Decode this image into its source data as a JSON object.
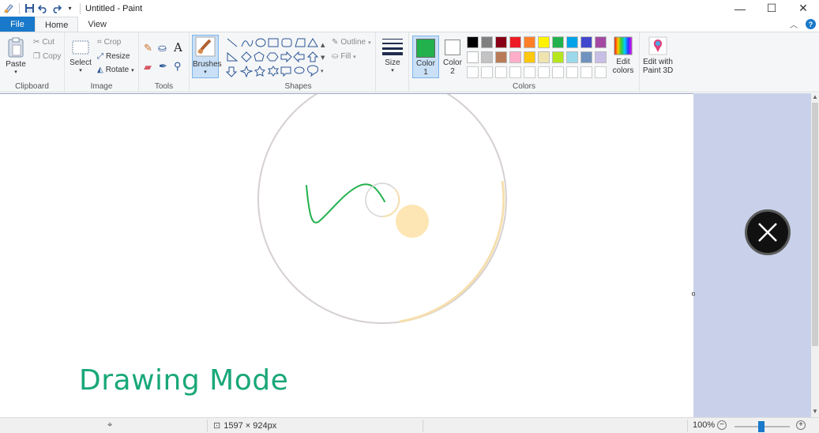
{
  "window": {
    "title": "Untitled - Paint"
  },
  "tabs": {
    "file": "File",
    "home": "Home",
    "view": "View"
  },
  "ribbon": {
    "clipboard": {
      "paste": "Paste",
      "cut": "Cut",
      "copy": "Copy",
      "label": "Clipboard"
    },
    "image": {
      "select": "Select",
      "crop": "Crop",
      "resize": "Resize",
      "rotate": "Rotate",
      "label": "Image"
    },
    "tools": {
      "label": "Tools",
      "brushes": "Brushes"
    },
    "shapes": {
      "outline": "Outline",
      "fill": "Fill",
      "label": "Shapes"
    },
    "size": {
      "label": "Size"
    },
    "colors": {
      "color1": "Color 1",
      "color1_value": "#22b14c",
      "color2": "Color 2",
      "color2_value": "#ffffff",
      "edit_colors": "Edit colors",
      "label": "Colors",
      "row1": [
        "#000000",
        "#7f7f7f",
        "#880015",
        "#ed1c24",
        "#ff7f27",
        "#fff200",
        "#22b14c",
        "#00a2e8",
        "#3f48cc",
        "#a349a4"
      ],
      "row2": [
        "#ffffff",
        "#c3c3c3",
        "#b97a57",
        "#ffaec9",
        "#ffc90e",
        "#efe4b0",
        "#b5e61d",
        "#99d9ea",
        "#7092be",
        "#c8bfe7"
      ]
    },
    "paint3d": "Edit with Paint 3D"
  },
  "canvas": {
    "overlay_text": "Drawing Mode"
  },
  "status": {
    "dimensions": "1597 × 924px",
    "zoom": "100%"
  },
  "icons": [
    "paint-app-icon",
    "save-icon",
    "undo-icon",
    "redo-icon",
    "minimize-icon",
    "maximize-icon",
    "close-icon",
    "help-icon",
    "close-circle-icon"
  ]
}
